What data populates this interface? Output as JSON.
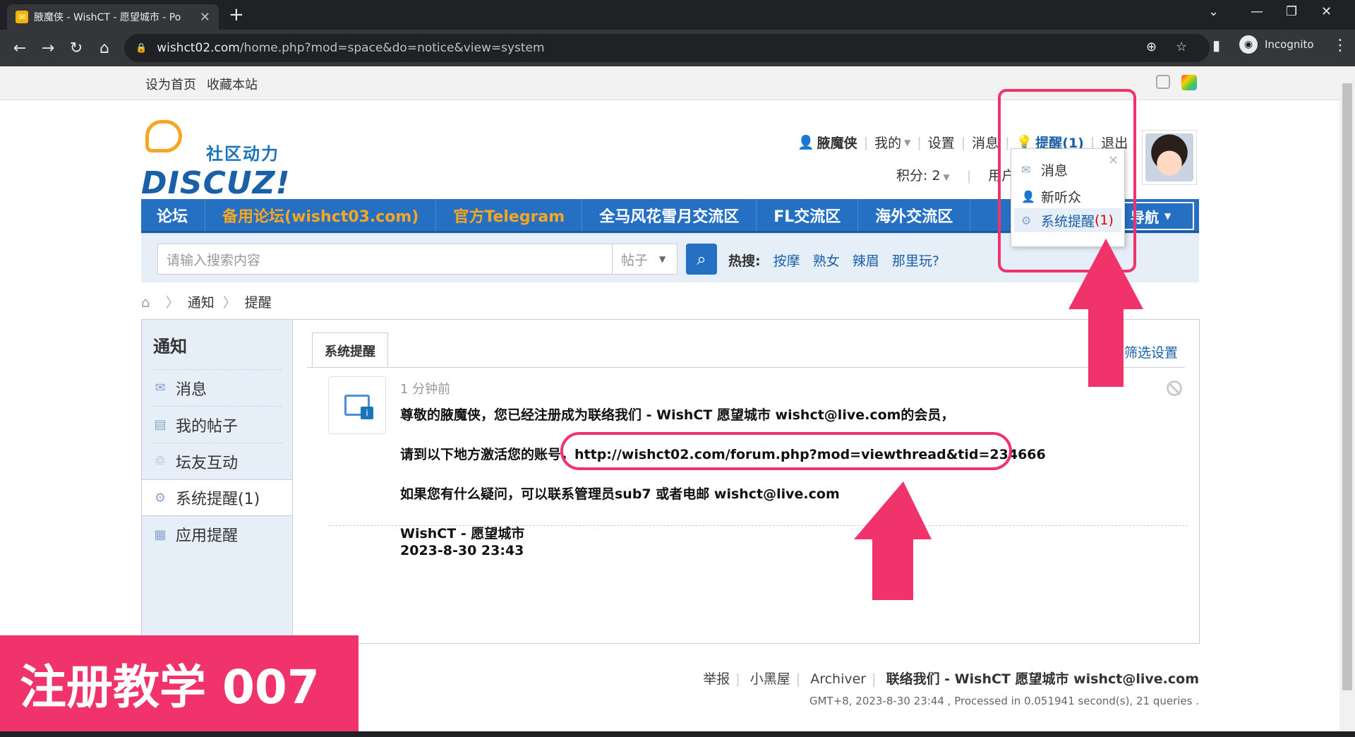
{
  "browser": {
    "tab_title": "腋魔侠 - WishCT - 愿望城市 - Po",
    "url_host": "wishct02.com",
    "url_path": "/home.php?mod=space&do=notice&view=system",
    "incognito_label": "Incognito"
  },
  "topbar": {
    "set_home": "设为首页",
    "bookmark": "收藏本站"
  },
  "logo": {
    "cn": "社区动力",
    "en": "DISCUZ!"
  },
  "user": {
    "name": "腋魔侠",
    "my": "我的",
    "settings": "设置",
    "messages": "消息",
    "remind": "提醒(1)",
    "logout": "退出",
    "points": "积分: 2",
    "user_group": "用户"
  },
  "nav": {
    "items": [
      "论坛",
      "备用论坛(wishct03.com)",
      "官方Telegram",
      "全马风花雪月交流区",
      "FL交流区",
      "海外交流区"
    ],
    "last": "导航"
  },
  "search": {
    "placeholder": "请输入搜索内容",
    "type": "帖子",
    "hot_label": "热搜:",
    "hot_words": [
      "按摩",
      "熟女",
      "辣眉",
      "那里玩?"
    ]
  },
  "breadcrumb": {
    "items": [
      "通知",
      "提醒"
    ]
  },
  "sidebar": {
    "header": "通知",
    "items": [
      "消息",
      "我的帖子",
      "坛友互动",
      "系统提醒(1)",
      "应用提醒"
    ]
  },
  "main": {
    "tab": "系统提醒",
    "filter": "筛选设置",
    "notice": {
      "time": "1 分钟前",
      "line1": "尊敬的腋魔侠，您已经注册成为联络我们 - WishCT 愿望城市 wishct@live.com的会员，",
      "line2_prefix": "请到以下地方激活您的账号，",
      "line2_url": "http://wishct02.com/forum.php?mod=viewthread&tid=234666",
      "line3": "如果您有什么疑问，可以联系管理员sub7 或者电邮 wishct@live.com",
      "line4": "WishCT - 愿望城市",
      "line5": "2023-8-30 23:43"
    }
  },
  "popup": {
    "items": [
      "消息",
      "新听众",
      "系统提醒"
    ],
    "count": "(1)"
  },
  "footer": {
    "links": [
      "举报",
      "小黑屋",
      "Archiver"
    ],
    "contact": "联络我们 - WishCT 愿望城市 wishct@live.com",
    "meta": "GMT+8, 2023-8-30 23:44 , Processed in 0.051941 second(s), 21 queries ."
  },
  "banner": {
    "text": "注册教学  007"
  },
  "colors": {
    "accent": "#2670c4",
    "highlight": "#f0336b",
    "nav_orange": "#f6a623"
  }
}
